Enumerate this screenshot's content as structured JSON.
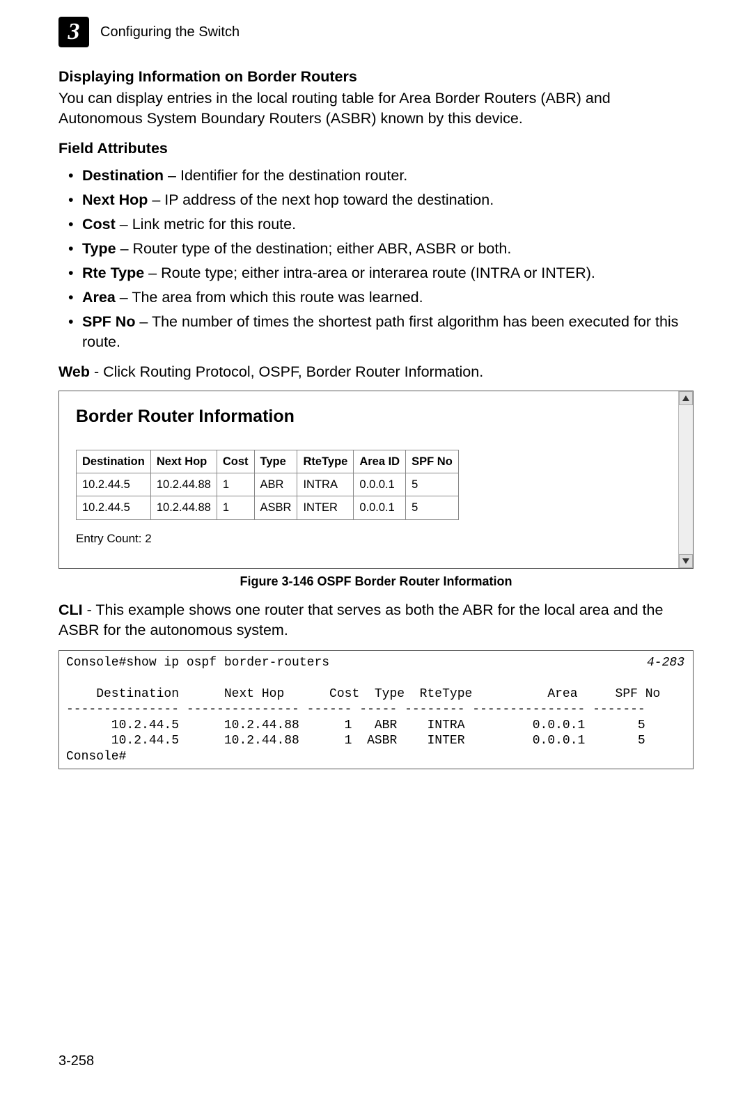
{
  "chapter": {
    "number": "3",
    "title": "Configuring the Switch"
  },
  "section": {
    "heading": "Displaying Information on Border Routers",
    "intro": "You can display entries in the local routing table for Area Border Routers (ABR) and Autonomous System Boundary Routers (ASBR) known by this device.",
    "subhead": "Field Attributes",
    "attrs": [
      {
        "name": "Destination",
        "desc": "Identifier for the destination router."
      },
      {
        "name": "Next Hop",
        "desc": "IP address of the next hop toward the destination."
      },
      {
        "name": "Cost",
        "desc": "Link metric for this route."
      },
      {
        "name": "Type",
        "desc": "Router type of the destination; either ABR, ASBR or both."
      },
      {
        "name": "Rte Type",
        "desc": "Route type; either intra-area or interarea route (INTRA or INTER)."
      },
      {
        "name": "Area",
        "desc": "The area from which this route was learned."
      },
      {
        "name": "SPF No",
        "desc": "The number of times the shortest path first algorithm has been executed for this route."
      }
    ],
    "web_label": "Web",
    "web_text": " - Click Routing Protocol, OSPF, Border Router Information."
  },
  "figure": {
    "heading": "Border Router Information",
    "columns": [
      "Destination",
      "Next Hop",
      "Cost",
      "Type",
      "RteType",
      "Area ID",
      "SPF No"
    ],
    "rows": [
      {
        "destination": "10.2.44.5",
        "next_hop": "10.2.44.88",
        "cost": "1",
        "type": "ABR",
        "rtetype": "INTRA",
        "area_id": "0.0.0.1",
        "spf_no": "5"
      },
      {
        "destination": "10.2.44.5",
        "next_hop": "10.2.44.88",
        "cost": "1",
        "type": "ASBR",
        "rtetype": "INTER",
        "area_id": "0.0.0.1",
        "spf_no": "5"
      }
    ],
    "entry_count": "Entry Count: 2",
    "caption": "Figure 3-146   OSPF Border Router Information"
  },
  "cli": {
    "label": "CLI",
    "intro": " - This example shows one router that serves as both the ABR for the local area and the ASBR for the autonomous system.",
    "ref": "4-283",
    "text": "Console#show ip ospf border-routers\n\n    Destination      Next Hop      Cost  Type  RteType          Area     SPF No\n--------------- --------------- ------ ----- -------- --------------- -------\n      10.2.44.5      10.2.44.88      1   ABR    INTRA         0.0.0.1       5\n      10.2.44.5      10.2.44.88      1  ASBR    INTER         0.0.0.1       5\nConsole#"
  },
  "page_number": "3-258"
}
